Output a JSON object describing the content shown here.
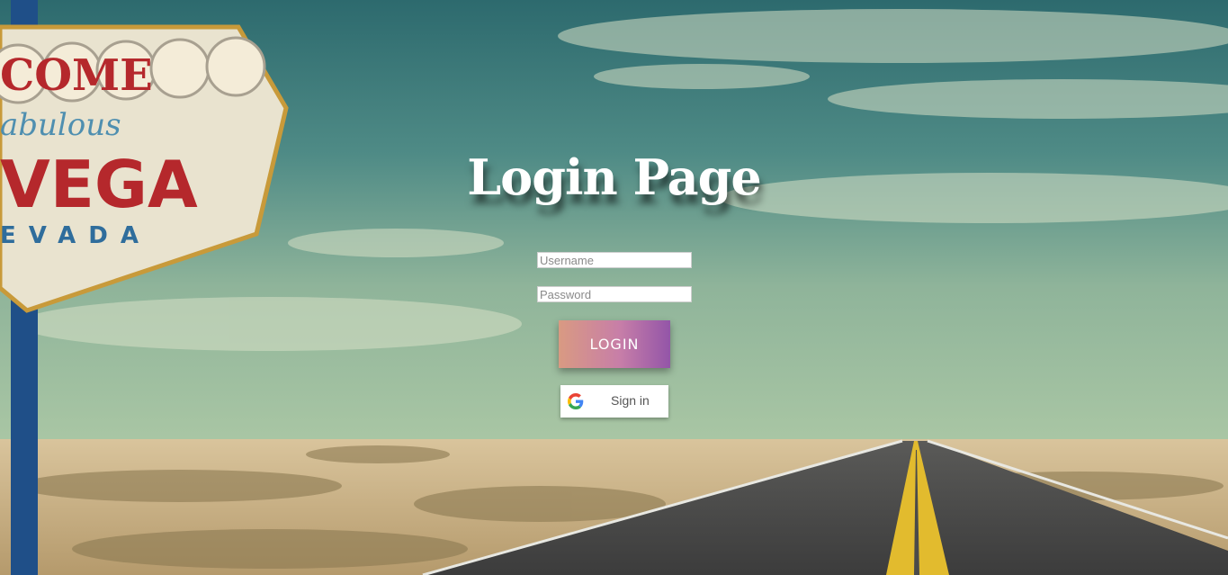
{
  "page": {
    "title": "Login Page"
  },
  "form": {
    "username": {
      "value": "",
      "placeholder": "Username"
    },
    "password": {
      "value": "",
      "placeholder": "Password"
    },
    "login_label": "LOGIN",
    "google_signin_label": "Sign in"
  },
  "background": {
    "description_icon": "las-vegas-desert-road-background",
    "sign_text": {
      "top": "COME",
      "middle": "VEGA",
      "script": "abulous",
      "bottom": "EVADA"
    }
  },
  "colors": {
    "login_gradient_start": "#d99a82",
    "login_gradient_end": "#9355a8",
    "title_text": "#ffffff"
  }
}
